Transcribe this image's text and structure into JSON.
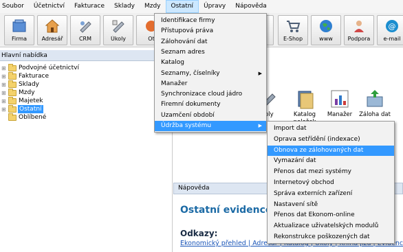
{
  "menubar": {
    "items": [
      "Soubor",
      "Účetnictví",
      "Fakturace",
      "Sklady",
      "Mzdy",
      "Ostatní",
      "Úpravy",
      "Nápověda"
    ],
    "active_index": 5
  },
  "toolbar": {
    "buttons": [
      {
        "label": "Firma",
        "icon": "firm-icon"
      },
      {
        "label": "Adresář",
        "icon": "address-book-icon"
      },
      {
        "label": "CRM",
        "icon": "crm-icon"
      },
      {
        "label": "Úkoly",
        "icon": "tasks-icon"
      },
      {
        "label": "Ot",
        "icon": "questions-icon"
      },
      {
        "label": "er",
        "icon": "manager-icon"
      },
      {
        "label": "E-Shop",
        "icon": "cart-icon"
      },
      {
        "label": "www",
        "icon": "globe-icon"
      },
      {
        "label": "Podpora",
        "icon": "support-icon"
      },
      {
        "label": "e-mail",
        "icon": "email-icon"
      }
    ]
  },
  "left_panel": {
    "title": "Hlavní nabídka",
    "tree": [
      {
        "label": "Podvojné účetnictví",
        "expandable": true,
        "selected": false
      },
      {
        "label": "Fakturace",
        "expandable": true,
        "selected": false
      },
      {
        "label": "Sklady",
        "expandable": true,
        "selected": false
      },
      {
        "label": "Mzdy",
        "expandable": true,
        "selected": false
      },
      {
        "label": "Majetek",
        "expandable": true,
        "selected": false
      },
      {
        "label": "Ostatní",
        "expandable": true,
        "selected": true
      },
      {
        "label": "Oblíbené",
        "expandable": false,
        "selected": false
      }
    ]
  },
  "content_icons": [
    {
      "label": "koly",
      "icon": "tasks-icon"
    },
    {
      "label": "Katalog položek",
      "icon": "catalog-icon"
    },
    {
      "label": "Manažer",
      "icon": "chart-icon"
    },
    {
      "label": "Záloha dat",
      "icon": "backup-icon"
    }
  ],
  "ostatni_menu": [
    {
      "label": "Identifikace firmy",
      "u": "I",
      "submenu": false,
      "highlighted": false
    },
    {
      "label": "Přístupová práva",
      "u": "P",
      "submenu": false,
      "highlighted": false
    },
    {
      "label": "Zálohování dat",
      "u": "Z",
      "submenu": false,
      "highlighted": false
    },
    {
      "label": "Seznam adres",
      "u": "a",
      "submenu": false,
      "highlighted": false
    },
    {
      "label": "Katalog",
      "u": "K",
      "submenu": false,
      "highlighted": false
    },
    {
      "label": "Seznamy, číselníky",
      "u": "S",
      "submenu": true,
      "highlighted": false
    },
    {
      "label": "Manažer",
      "u": "M",
      "submenu": false,
      "highlighted": false
    },
    {
      "label": "Synchronizace cloud jádro",
      "u": "c",
      "submenu": false,
      "highlighted": false
    },
    {
      "label": "Firemní dokumenty",
      "u": "F",
      "submenu": false,
      "highlighted": false
    },
    {
      "label": "Uzamčení období",
      "u": "U",
      "submenu": false,
      "highlighted": false
    },
    {
      "label": "Údržba systému",
      "u": "d",
      "submenu": true,
      "highlighted": true
    }
  ],
  "udrzba_menu": [
    {
      "label": "Import dat",
      "highlighted": false
    },
    {
      "label": "Oprava setřídění (indexace)",
      "highlighted": false
    },
    {
      "label": "Obnova ze zálohovaných dat",
      "highlighted": true
    },
    {
      "label": "Vymazání dat",
      "highlighted": false
    },
    {
      "label": "Přenos dat mezi systémy",
      "highlighted": false
    },
    {
      "label": "Internetový obchod",
      "highlighted": false
    },
    {
      "label": "Správa externích zařízení",
      "highlighted": false
    },
    {
      "label": "Nastavení sítě",
      "highlighted": false
    },
    {
      "label": "Přenos dat Ekonom-online",
      "highlighted": false
    },
    {
      "label": "Aktualizace uživatelských modulů",
      "highlighted": false
    },
    {
      "label": "Rekonstrukce poškozených dat",
      "highlighted": false
    }
  ],
  "help": {
    "header": "Nápověda",
    "title": "Ostatní evidence",
    "links_heading": "Odkazy:",
    "links_row": "Ekonomický přehled | Adresář | Katalog | Úkoly | Kniha jízd | Evidence"
  },
  "colors": {
    "highlight": "#3399ff",
    "panel_header": "#dde6f2",
    "help_title": "#1b6aa5"
  }
}
